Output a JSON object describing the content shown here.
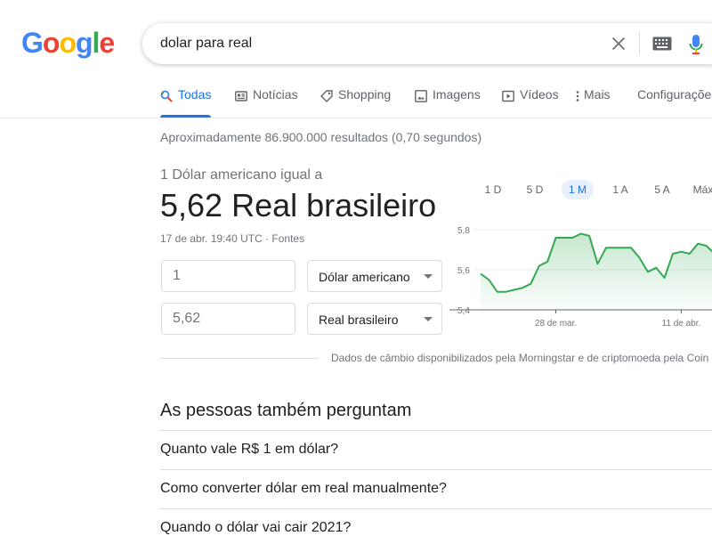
{
  "logo": {
    "letters": [
      "G",
      "o",
      "o",
      "g",
      "l",
      "e"
    ],
    "colors": [
      "#4285F4",
      "#EA4335",
      "#FBBC05",
      "#4285F4",
      "#34A853",
      "#EA4335"
    ]
  },
  "search": {
    "query": "dolar para real"
  },
  "tabs": [
    {
      "label": "Todas",
      "icon": "search-icon",
      "active": true
    },
    {
      "label": "Notícias",
      "icon": "news-icon"
    },
    {
      "label": "Shopping",
      "icon": "tag-icon"
    },
    {
      "label": "Imagens",
      "icon": "image-icon"
    },
    {
      "label": "Vídeos",
      "icon": "video-icon"
    },
    {
      "label": "Mais",
      "icon": "more-vert-icon"
    },
    {
      "label": "Configurações"
    }
  ],
  "results_count": "Aproximadamente 86.900.000 resultados (0,70 segundos)",
  "currency": {
    "equal_line": "1 Dólar americano igual a",
    "big_value": "5,62 Real brasileiro",
    "timestamp": "17 de abr. 19:40 UTC · Fontes",
    "from_amount": "1",
    "from_currency": "Dólar americano",
    "to_amount": "5,62",
    "to_currency": "Real brasileiro"
  },
  "ranges": [
    "1 D",
    "5 D",
    "1 M",
    "1 A",
    "5 A",
    "Máx"
  ],
  "active_range": "1 M",
  "source_text": "Dados de câmbio disponibilizados pela Morningstar e de criptomoeda pela Coin",
  "colors": {
    "accent": "#1a73e8",
    "chart_line": "#34a853"
  },
  "chart_data": {
    "type": "area",
    "y_ticks": [
      "5,8",
      "5,6",
      "5,4"
    ],
    "ylim": [
      5.4,
      5.8
    ],
    "x_ticks": [
      "28 de mar.",
      "11 de abr."
    ],
    "values": [
      5.58,
      5.55,
      5.49,
      5.49,
      5.5,
      5.51,
      5.53,
      5.62,
      5.64,
      5.76,
      5.76,
      5.76,
      5.78,
      5.77,
      5.63,
      5.71,
      5.71,
      5.71,
      5.71,
      5.66,
      5.59,
      5.61,
      5.56,
      5.68,
      5.69,
      5.68,
      5.73,
      5.72,
      5.68
    ]
  },
  "paa": {
    "title": "As pessoas também perguntam",
    "questions": [
      "Quanto vale R$ 1 em dólar?",
      "Como converter dólar em real manualmente?",
      "Quando o dólar vai cair 2021?"
    ]
  }
}
